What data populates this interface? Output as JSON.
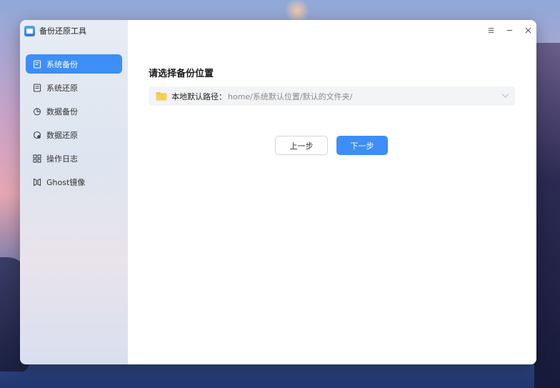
{
  "app": {
    "title": "备份还原工具"
  },
  "sidebar": {
    "items": [
      {
        "label": "系统备份",
        "icon": "system-backup-icon",
        "active": true
      },
      {
        "label": "系统还原",
        "icon": "system-restore-icon",
        "active": false
      },
      {
        "label": "数据备份",
        "icon": "data-backup-icon",
        "active": false
      },
      {
        "label": "数据还原",
        "icon": "data-restore-icon",
        "active": false
      },
      {
        "label": "操作日志",
        "icon": "grid-log-icon",
        "active": false
      },
      {
        "label": "Ghost镜像",
        "icon": "ghost-image-icon",
        "active": false
      }
    ]
  },
  "main": {
    "title": "请选择备份位置",
    "path": {
      "label": "本地默认路径：",
      "value": "home/系统默认位置/默认的文件夹/"
    },
    "buttons": {
      "prev": "上一步",
      "next": "下一步"
    }
  },
  "colors": {
    "accent": "#3d8ef7",
    "folder": "#f5c343"
  }
}
